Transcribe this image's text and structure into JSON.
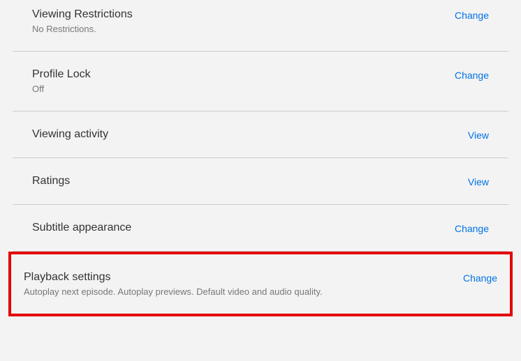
{
  "settings": [
    {
      "title": "Viewing Restrictions",
      "subtitle": "No Restrictions.",
      "action": "Change"
    },
    {
      "title": "Profile Lock",
      "subtitle": "Off",
      "action": "Change"
    },
    {
      "title": "Viewing activity",
      "subtitle": "",
      "action": "View"
    },
    {
      "title": "Ratings",
      "subtitle": "",
      "action": "View"
    },
    {
      "title": "Subtitle appearance",
      "subtitle": "",
      "action": "Change"
    },
    {
      "title": "Playback settings",
      "subtitle": "Autoplay next episode. Autoplay previews. Default video and audio quality.",
      "action": "Change"
    }
  ]
}
